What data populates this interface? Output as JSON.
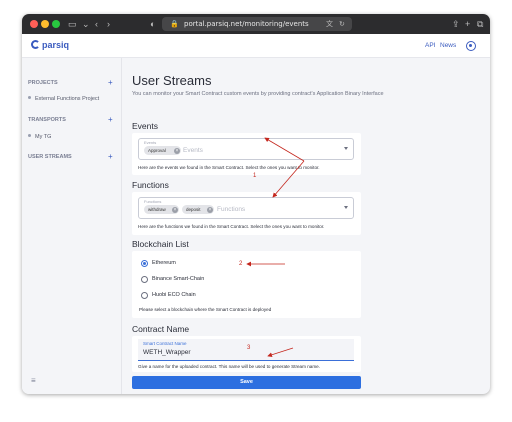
{
  "browser": {
    "url": "portal.parsiq.net/monitoring/events",
    "colors": {
      "close": "#ff5f57",
      "minimize": "#febc2e",
      "maximize": "#28c840"
    }
  },
  "header": {
    "logo": "parsiq",
    "nav": [
      "API",
      "News"
    ]
  },
  "sidebar": {
    "sections": [
      {
        "title": "PROJECTS",
        "items": [
          "External Functions Project"
        ]
      },
      {
        "title": "TRANSPORTS",
        "items": [
          "My TG"
        ]
      },
      {
        "title": "USER STREAMS",
        "items": []
      }
    ],
    "add_icon": "+",
    "footer_icon": "≡"
  },
  "main": {
    "title": "User Streams",
    "description": "You can monitor your Smart Contract custom events by providing contract's Application Binary Interface",
    "events": {
      "heading": "Events",
      "field_label": "Events",
      "chips": [
        "Approval"
      ],
      "placeholder": "Events",
      "helper": "Here are the events we found in the Smart Contract. Select the ones you want to monitor."
    },
    "functions": {
      "heading": "Functions",
      "field_label": "Functions",
      "chips": [
        "withdraw",
        "deposit"
      ],
      "placeholder": "Functions",
      "helper": "Here are the functions we found in the Smart Contract. Select the ones you want to monitor."
    },
    "blockchain": {
      "heading": "Blockchain List",
      "options": [
        "Ethereum",
        "Binance Smart-Chain",
        "Huobi ECO Chain"
      ],
      "selected": "Ethereum",
      "helper": "Please select a blockchain where the Smart Contract is deployed"
    },
    "contract": {
      "heading": "Contract Name",
      "field_label": "Smart Contract Name",
      "value": "WETH_Wrapper",
      "helper": "Give a name for the uploaded contract. This name will be used to generate Stream name."
    },
    "save_label": "Save"
  },
  "annotations": {
    "color": "#c4261d",
    "labels": [
      "1",
      "2",
      "3"
    ]
  }
}
